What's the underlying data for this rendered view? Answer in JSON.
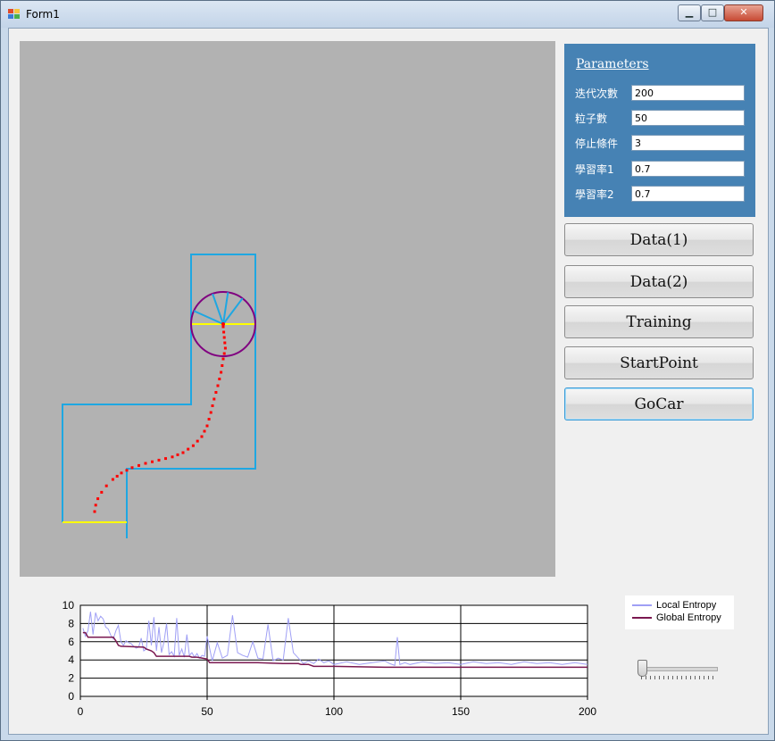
{
  "window": {
    "title": "Form1",
    "controls": {
      "minimize": "▁",
      "maximize": "□",
      "close": "✕"
    }
  },
  "params": {
    "title": "Parameters",
    "fields": [
      {
        "label": "迭代次數",
        "value": "200"
      },
      {
        "label": "粒子數",
        "value": "50"
      },
      {
        "label": "停止條件",
        "value": "3"
      },
      {
        "label": "學習率1",
        "value": "0.7"
      },
      {
        "label": "學習率2",
        "value": "0.7"
      }
    ]
  },
  "buttons": {
    "data1": "Data(1)",
    "data2": "Data(2)",
    "training": "Training",
    "start_point": "StartPoint",
    "go_car": "GoCar"
  },
  "colors": {
    "track_wall": "#1ea7e2",
    "start_finish": "#ffff00",
    "path": "#ff0000",
    "car": "#800080",
    "sensor": "#1ea7e2",
    "canvas_bg": "#b2b2b2",
    "panel": "#4682b4"
  },
  "track": {
    "walls": [
      [
        -6,
        0
      ],
      [
        -6,
        22
      ],
      [
        18,
        22
      ],
      [
        18,
        50
      ],
      [
        30,
        50
      ],
      [
        30,
        10
      ],
      [
        6,
        10
      ],
      [
        6,
        -3
      ]
    ],
    "start_line": [
      [
        -6,
        0
      ],
      [
        6,
        0
      ]
    ],
    "finish_line": [
      [
        18,
        37
      ],
      [
        30,
        37
      ]
    ]
  },
  "car": {
    "center": [
      24,
      37
    ],
    "radius": 3,
    "path": [
      [
        0,
        2
      ],
      [
        0.2,
        3.2
      ],
      [
        0.6,
        4.4
      ],
      [
        1.3,
        5.6
      ],
      [
        2.2,
        6.8
      ],
      [
        3.4,
        8
      ],
      [
        5,
        9.2
      ],
      [
        7,
        10.2
      ],
      [
        9.5,
        11
      ],
      [
        12,
        11.6
      ],
      [
        14.5,
        12.2
      ],
      [
        16.5,
        13
      ],
      [
        18.4,
        14.3
      ],
      [
        20,
        16
      ],
      [
        21,
        18
      ],
      [
        21.7,
        20.5
      ],
      [
        22.3,
        23
      ],
      [
        23,
        25.5
      ],
      [
        23.6,
        28
      ],
      [
        24,
        30.5
      ],
      [
        24.4,
        32.5
      ],
      [
        24.2,
        34.5
      ],
      [
        24,
        36.5
      ],
      [
        24,
        37
      ]
    ]
  },
  "chart_data": {
    "type": "line",
    "xlim": [
      0,
      200
    ],
    "ylim": [
      0,
      10
    ],
    "xticks": [
      0,
      50,
      100,
      150,
      200
    ],
    "yticks": [
      0,
      2,
      4,
      6,
      8,
      10
    ],
    "grid": true,
    "legend_position": "right",
    "series": [
      {
        "name": "Local Entropy",
        "color": "#9f9ff5",
        "x": [
          1,
          2,
          3,
          4,
          5,
          6,
          7,
          8,
          9,
          10,
          11,
          12,
          13,
          14,
          15,
          16,
          17,
          18,
          19,
          20,
          21,
          22,
          23,
          24,
          25,
          26,
          27,
          28,
          29,
          30,
          31,
          32,
          33,
          34,
          35,
          36,
          37,
          38,
          39,
          40,
          41,
          42,
          43,
          44,
          45,
          46,
          47,
          48,
          49,
          50,
          52,
          54,
          56,
          58,
          60,
          62,
          64,
          66,
          68,
          70,
          72,
          74,
          76,
          78,
          80,
          82,
          84,
          86,
          88,
          90,
          92,
          94,
          96,
          98,
          100,
          105,
          110,
          115,
          120,
          122,
          124,
          125,
          126,
          128,
          130,
          135,
          140,
          145,
          150,
          155,
          160,
          165,
          170,
          175,
          180,
          185,
          190,
          195,
          200
        ],
        "y": [
          7.5,
          6.6,
          7.2,
          9.3,
          6.8,
          9.2,
          8.3,
          8.8,
          8.5,
          7.6,
          7.4,
          6.7,
          6.3,
          7.2,
          7.8,
          6.0,
          5.6,
          6.1,
          5.9,
          5.8,
          5.5,
          5.3,
          5.4,
          6.4,
          5.0,
          5.2,
          8.3,
          5.6,
          8.7,
          5.0,
          7.6,
          4.8,
          6.0,
          8.0,
          4.6,
          4.9,
          4.4,
          8.6,
          4.5,
          5.2,
          4.3,
          6.8,
          4.5,
          4.8,
          4.3,
          4.7,
          4.2,
          4.5,
          4.4,
          6.6,
          3.9,
          5.9,
          4.2,
          4.5,
          8.9,
          4.8,
          4.5,
          4.3,
          6.0,
          4.2,
          4.1,
          7.9,
          3.9,
          4.2,
          4.0,
          8.6,
          4.8,
          4.2,
          3.6,
          3.9,
          3.6,
          4.1,
          3.7,
          3.9,
          3.5,
          3.8,
          3.5,
          3.7,
          3.9,
          3.6,
          3.4,
          6.5,
          3.5,
          3.7,
          3.5,
          3.8,
          3.6,
          3.7,
          3.5,
          3.8,
          3.6,
          3.7,
          3.5,
          3.8,
          3.6,
          3.7,
          3.5,
          3.7,
          3.5
        ]
      },
      {
        "name": "Global Entropy",
        "color": "#7a1850",
        "x": [
          1,
          2,
          3,
          13,
          14,
          15,
          16,
          25,
          26,
          28,
          29,
          30,
          43,
          44,
          45,
          46,
          50,
          51,
          70,
          80,
          86,
          87,
          88,
          90,
          91,
          92,
          100,
          120,
          150,
          200
        ],
        "y": [
          7.0,
          7.0,
          6.5,
          6.5,
          6.1,
          5.6,
          5.5,
          5.4,
          5.2,
          5.0,
          4.8,
          4.4,
          4.4,
          4.3,
          4.3,
          4.3,
          4.1,
          3.7,
          3.7,
          3.6,
          3.6,
          3.5,
          3.5,
          3.5,
          3.4,
          3.3,
          3.3,
          3.2,
          3.2,
          3.2
        ]
      }
    ]
  },
  "slider": {
    "value": 0
  }
}
